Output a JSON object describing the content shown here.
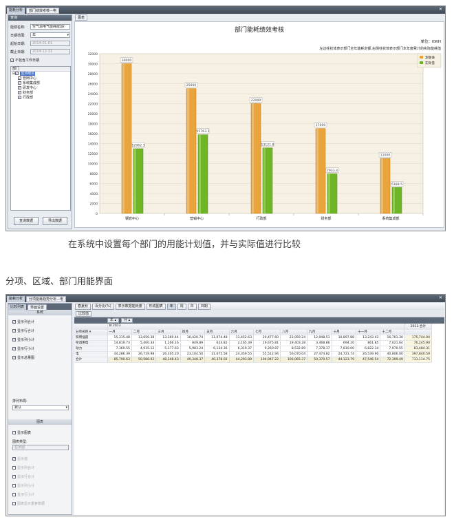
{
  "win1": {
    "tabs": [
      "能耗分析",
      "部门绩效考核—电"
    ],
    "panel_title": "查询",
    "form": {
      "energy_label": "能源名称:",
      "energy_value": "空气源电气能耗能源(·",
      "date_range_label": "日期范围:",
      "date_range_value": "年",
      "start_label": "起始日期:",
      "start_value": "2014-01-01",
      "end_label": "截止日期:",
      "end_value": "2014-12-31",
      "exclude_label": "不包含工作日期"
    },
    "tree": {
      "header": "部门",
      "root": "监测楼层",
      "items": [
        "管网中心",
        "系统集成部",
        "研发中心",
        "财务部",
        "行政部"
      ]
    },
    "buttons": {
      "query": "查询数据",
      "export": "导出数据"
    },
    "chart_tab": "图表"
  },
  "chart_data": {
    "type": "bar",
    "title": "部门能耗绩效考核",
    "unit_label": "单位：KWH",
    "subtitle": "左边柱状体表示部门全年能耗定额,右侧柱状体表示部门本年度累计的实际能耗值",
    "categories": [
      "钢管中心",
      "营销中心",
      "行政部",
      "财务部",
      "系统集成部"
    ],
    "series": [
      {
        "name": "定额值",
        "values": [
          30000,
          25000,
          22000,
          17000,
          11000
        ],
        "labels": [
          "30000",
          "25000",
          "22000",
          "17000",
          "11000"
        ],
        "color": "#e9a43c"
      },
      {
        "name": "实际值",
        "values": [
          12962.3,
          15763.1,
          13121.8,
          7933.4,
          5188.5
        ],
        "labels": [
          "12962.3",
          "15763.1",
          "13121.8",
          "7933.4",
          "5188.5"
        ],
        "color": "#6fb626"
      }
    ],
    "ylim": [
      0,
      32000
    ],
    "yticks": [
      0,
      2000,
      4000,
      6000,
      8000,
      10000,
      12000,
      14000,
      16000,
      18000,
      20000,
      22000,
      24000,
      26000,
      28000,
      30000,
      32000
    ],
    "grid": true,
    "legend": "top-right"
  },
  "caption1": "在系统中设置每个部门的用能计划值，并与实际值进行比较",
  "heading2": "分项、区域、部门用能界面",
  "win2": {
    "tabs": [
      "能耗分析",
      "分项能耗趋势分析—电"
    ],
    "left_tabs": [
      "比较列表",
      "界面设置"
    ],
    "section_system": "系统",
    "options": [
      "显示列合计",
      "显示行合计",
      "显示列小计",
      "显示行小计",
      "显示总量图"
    ],
    "layout_label": "排列布局:",
    "layout_value": "默认",
    "section_chart": "图表",
    "show_chart": "显示图表",
    "chart_type_label": "图表类型:",
    "chart_type_value": "柱状图",
    "chart_options": [
      "显示值",
      "显示列合计",
      "显示行合计",
      "显示列小计",
      "显示行小计",
      "图表显示重复数据"
    ],
    "toolbar": [
      "春夏秋",
      "百分比(%)",
      "表示数据能耗量",
      "形成图表",
      "年",
      "周",
      "日",
      "日期"
    ],
    "compare_label": "比较值",
    "field_chips": [
      "年",
      "月"
    ],
    "year_label": "2013",
    "year_total": "2013 合计",
    "col_header": "分项名称",
    "months": [
      "一月",
      "二月",
      "三月",
      "四月",
      "五月",
      "六月",
      "七月",
      "八月",
      "九月",
      "十月",
      "十一月",
      "十二月"
    ],
    "rows": [
      {
        "name": "照明插座",
        "values": [
          "15,315.48",
          "13,650.38",
          "13,369.44",
          "10,420.74",
          "11,074.48",
          "11,452.63",
          "20,477.60",
          "22,059.24",
          "12,948.51",
          "10,897.88",
          "13,243.43",
          "16,701.30"
        ],
        "total": "175,744.04"
      },
      {
        "name": "空调用电",
        "values": [
          "14,819.73",
          "5,400.34",
          "1,266.16",
          "849.89",
          "624.82",
          "2,165.39",
          "19,675.81",
          "19,403.28",
          "3,468.86",
          "694.20",
          "861.85",
          "7,021.64"
        ],
        "total": "76,245.90"
      },
      {
        "name": "动力",
        "values": [
          "7,369.55",
          "4,915.12",
          "5,177.63",
          "5,983.24",
          "6,134.36",
          "6,319.37",
          "9,260.87",
          "8,532.89",
          "7,378.37",
          "7,810.00",
          "6,822.34",
          "7,970.55"
        ],
        "total": "83,484.31"
      },
      {
        "name": "电",
        "values": [
          "44,286.39",
          "26,719.98",
          "26,305.20",
          "23,104.50",
          "21,675.58",
          "24,359.55",
          "55,512.94",
          "56,070.04",
          "27,474.82",
          "24,721.74",
          "26,539.90",
          "40,806.00"
        ],
        "total": "397,840.59"
      },
      {
        "name": "合计",
        "values": [
          "85,790.63",
          "50,586.02",
          "48,348.43",
          "40,348.37",
          "40,378.02",
          "44,293.89",
          "104,947.22",
          "106,065.37",
          "50,370.57",
          "44,123.79",
          "47,546.54",
          "72,399.49"
        ],
        "total": "733,114.75"
      }
    ]
  }
}
